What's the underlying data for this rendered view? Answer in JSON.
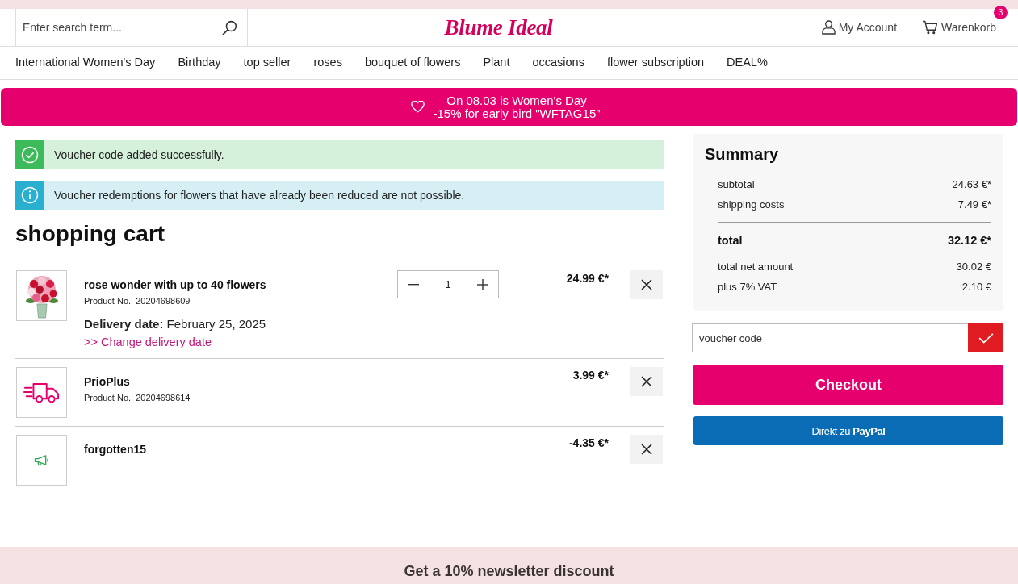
{
  "header": {
    "search": {
      "placeholder": "Enter search term..."
    },
    "logo": "Blume Ideal",
    "account": "My Account",
    "cart": {
      "label": "Warenkorb",
      "count": "3"
    }
  },
  "nav": [
    "International Women's Day",
    "Birthday",
    "top seller",
    "roses",
    "bouquet of flowers",
    "Plant",
    "occasions",
    "flower subscription",
    "DEAL%"
  ],
  "banner": {
    "lines": [
      "On 08.03 is Women's Day",
      "-15% for early bird \"WFTAG15\""
    ]
  },
  "alerts": [
    {
      "kind": "success",
      "text": "Voucher code added successfully."
    },
    {
      "kind": "info",
      "text": "Voucher redemptions for flowers that have already been reduced are not possible."
    }
  ],
  "cart": {
    "title": "shopping cart",
    "items": [
      {
        "kind": "bouquet",
        "name": "rose wonder with up to 40 flowers",
        "product_no": "Product No.: 20204698609",
        "quantity": "1",
        "delivery": "**Delivery date:** February 25, 2025",
        "change_link": ">> Change delivery date",
        "price": "24.99 €*"
      },
      {
        "kind": "shipping",
        "name": "PrioPlus",
        "product_no": "Product No.: 20204698614",
        "price": "3.99 €*"
      },
      {
        "kind": "voucher",
        "name": "forgotten15",
        "price": "-4.35 €*"
      }
    ]
  },
  "summary": {
    "title": "Summary",
    "rows": [
      {
        "kind": "item",
        "label": "subtotal",
        "value": "24.63 €*"
      },
      {
        "kind": "item",
        "label": "shipping costs",
        "value": "7.49 €*"
      },
      {
        "kind": "total",
        "label": "total",
        "value": "32.12 €*"
      },
      {
        "kind": "tax",
        "label": "total net amount",
        "value": "30.02 €"
      },
      {
        "kind": "tax",
        "label": "plus 7% VAT",
        "value": "2.10 €"
      }
    ]
  },
  "voucher": {
    "placeholder": "voucher code"
  },
  "checkout": "Checkout",
  "paypal": "Direkt zu **PayPal**",
  "newsletter": "Get a 10% newsletter discount"
}
